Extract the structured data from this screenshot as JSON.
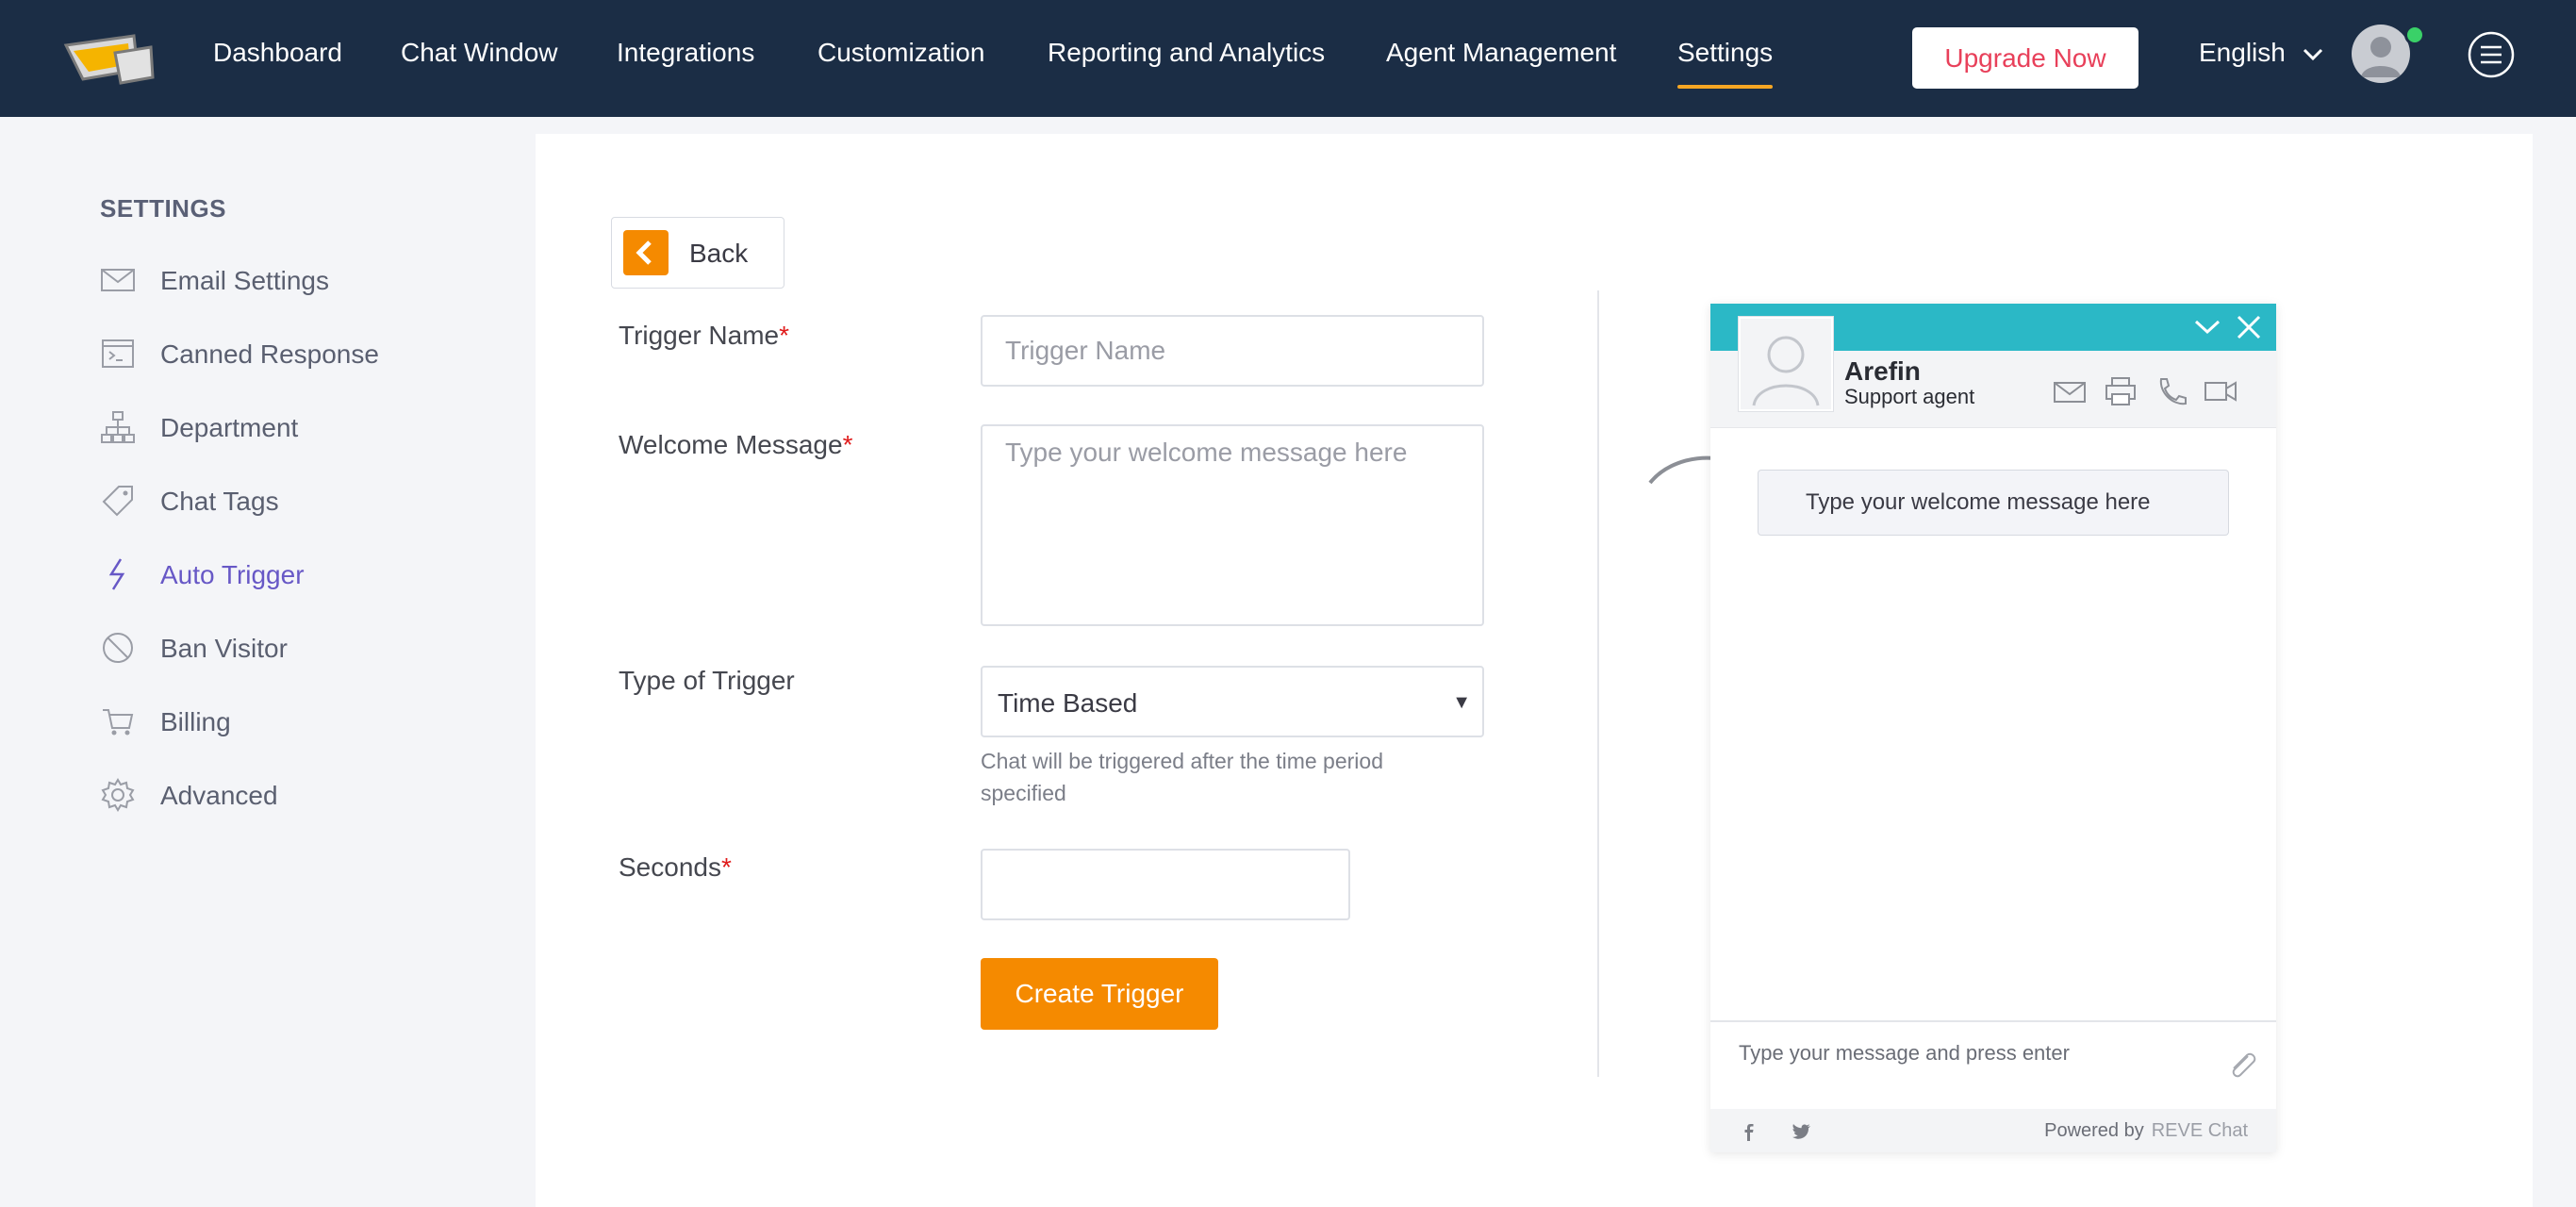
{
  "nav": {
    "items": [
      "Dashboard",
      "Chat Window",
      "Integrations",
      "Customization",
      "Reporting and Analytics",
      "Agent Management",
      "Settings"
    ],
    "active": "Settings",
    "upgrade_label": "Upgrade Now",
    "language": "English"
  },
  "sidebar": {
    "title": "SETTINGS",
    "items": [
      {
        "label": "Email Settings",
        "icon": "envelope-icon"
      },
      {
        "label": "Canned Response",
        "icon": "terminal-icon"
      },
      {
        "label": "Department",
        "icon": "org-chart-icon"
      },
      {
        "label": "Chat Tags",
        "icon": "tag-icon"
      },
      {
        "label": "Auto Trigger",
        "icon": "lightning-icon"
      },
      {
        "label": "Ban Visitor",
        "icon": "ban-icon"
      },
      {
        "label": "Billing",
        "icon": "cart-icon"
      },
      {
        "label": "Advanced",
        "icon": "gear-icon"
      }
    ],
    "active": "Auto Trigger"
  },
  "form": {
    "back_label": "Back",
    "trigger_name": {
      "label": "Trigger Name",
      "required": "*",
      "placeholder": "Trigger Name",
      "value": ""
    },
    "welcome_message": {
      "label": "Welcome Message",
      "required": "*",
      "placeholder": "Type your welcome message here",
      "value": ""
    },
    "trigger_type": {
      "label": "Type of Trigger",
      "selected": "Time Based",
      "hint": "Chat will be triggered after the time period specified"
    },
    "seconds": {
      "label": "Seconds",
      "required": "*",
      "value": ""
    },
    "create_label": "Create Trigger"
  },
  "preview": {
    "agent_name": "Arefin",
    "agent_role": "Support agent",
    "welcome_message": "Type your welcome message here",
    "input_placeholder": "Type your message and press enter",
    "powered_by": "Powered by",
    "brand": "REVE Chat",
    "header_color": "#2bb8c6"
  },
  "colors": {
    "nav_bg": "#1b2d45",
    "accent_orange": "#f58a00",
    "active_purple": "#6758c6",
    "upgrade_red": "#e8405a",
    "online_green": "#3ad168"
  }
}
